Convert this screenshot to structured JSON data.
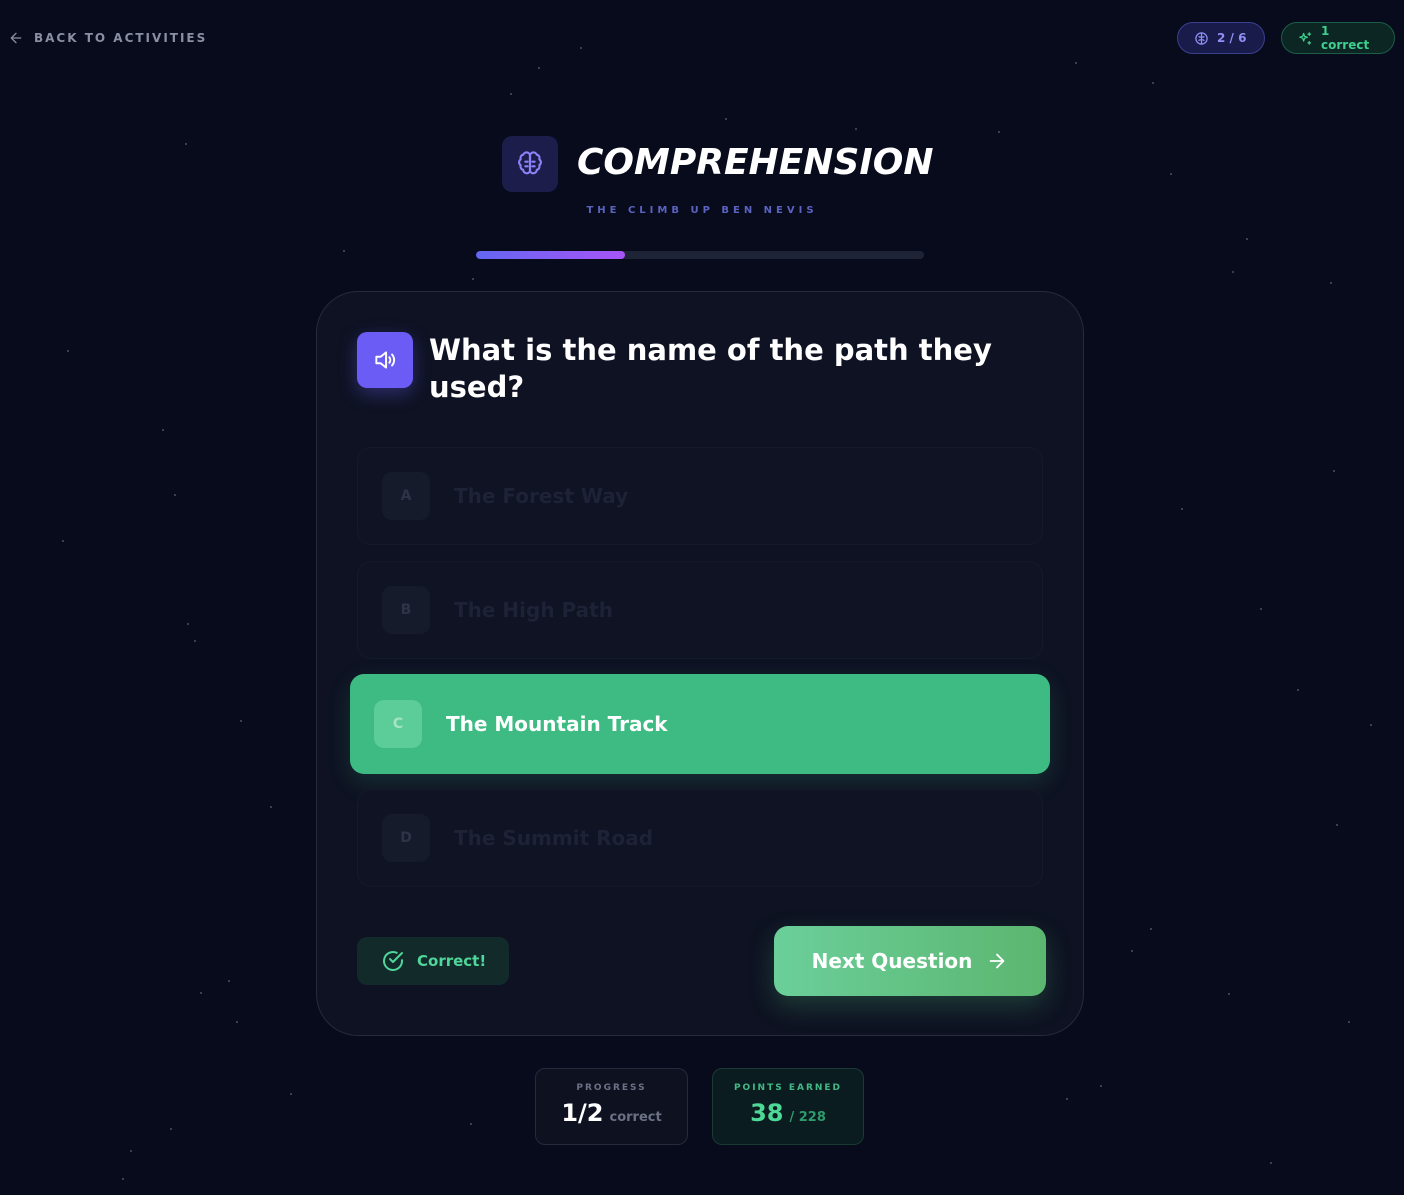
{
  "top_bar": {
    "back_label": "BACK TO ACTIVITIES",
    "question_counter": "2 / 6",
    "correct_count": "1 correct"
  },
  "header": {
    "title": "COMPREHENSION",
    "subtitle": "THE CLIMB UP BEN NEVIS",
    "progress_fraction": 0.333
  },
  "question": {
    "text": "What is the name of the path they used?"
  },
  "options": [
    {
      "letter": "A",
      "text": "The Forest Way",
      "state": "disabled"
    },
    {
      "letter": "B",
      "text": "The High Path",
      "state": "disabled"
    },
    {
      "letter": "C",
      "text": "The Mountain Track",
      "state": "selected-correct"
    },
    {
      "letter": "D",
      "text": "The Summit Road",
      "state": "disabled"
    }
  ],
  "feedback": {
    "label": "Correct!"
  },
  "next_button": {
    "label": "Next Question"
  },
  "stats": {
    "progress": {
      "label": "PROGRESS",
      "value": "1/2",
      "suffix": "correct"
    },
    "points": {
      "label": "POINTS EARNED",
      "value": "38",
      "suffix": "/ 228"
    }
  },
  "colors": {
    "background": "#070b1c",
    "accent_purple": "#6b5cf5",
    "success_green": "#3ebb83"
  },
  "icons": {
    "back": "arrow-left-icon",
    "counter": "brain-icon",
    "correct": "sparkles-icon",
    "header": "brain-icon",
    "speaker": "speaker-icon",
    "feedback": "check-circle-icon",
    "next": "arrow-right-icon"
  }
}
